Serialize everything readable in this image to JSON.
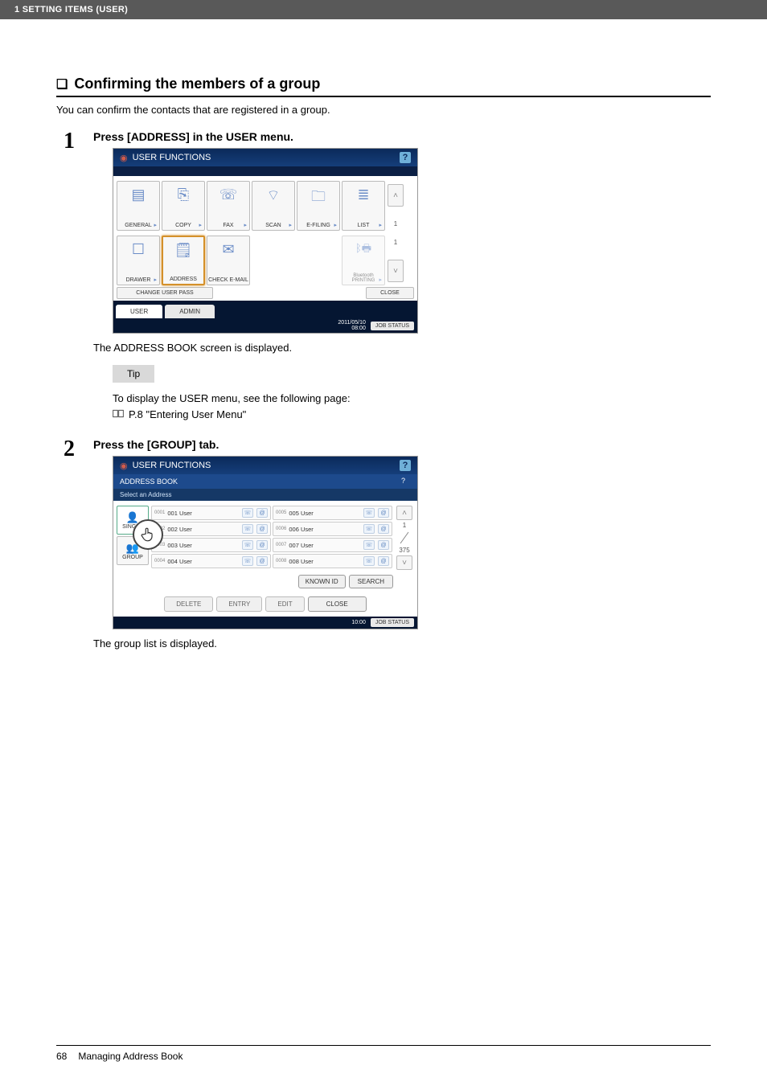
{
  "header": {
    "title": "1 SETTING ITEMS (USER)"
  },
  "section": {
    "bullet": "❏",
    "heading": "Confirming the members of a group",
    "intro": "You can confirm the contacts that are registered in a group."
  },
  "step1": {
    "num": "1",
    "title": "Press [ADDRESS] in the USER menu.",
    "caption": "The ADDRESS BOOK screen is displayed.",
    "panel": {
      "title": "USER FUNCTIONS",
      "help": "?",
      "tiles_row1": [
        {
          "label": "GENERAL"
        },
        {
          "label": "COPY"
        },
        {
          "label": "FAX"
        },
        {
          "label": "SCAN"
        },
        {
          "label": "E-FILING"
        },
        {
          "label": "LIST"
        }
      ],
      "tiles_row2": [
        {
          "label": "DRAWER"
        },
        {
          "label": "ADDRESS",
          "highlighted": true
        },
        {
          "label": "CHECK E-MAIL"
        },
        {
          "label": "Bluetooth PRINTING",
          "disabled": true
        }
      ],
      "pager_top": "1",
      "pager_bot": "1",
      "change_pw": "CHANGE USER PASS",
      "close": "CLOSE",
      "tabs": {
        "user": "USER",
        "admin": "ADMIN"
      },
      "status_date": "2011/05/10\n08:00",
      "status_btn": "JOB STATUS"
    }
  },
  "tip": {
    "label": "Tip",
    "line1": "To display the USER menu, see the following page:",
    "ref": "P.8 \"Entering User Menu\""
  },
  "step2": {
    "num": "2",
    "title": "Press the [GROUP] tab.",
    "caption": "The group list is displayed.",
    "panel": {
      "title": "USER FUNCTIONS",
      "subtitle": "ADDRESS BOOK",
      "help": "?",
      "select": "Select an Address",
      "side_single": "SINGLE",
      "side_group": "GROUP",
      "rows_left": [
        {
          "idx": "0001",
          "name": "001 User"
        },
        {
          "idx": "0002",
          "name": "002 User"
        },
        {
          "idx": "0003",
          "name": "003 User"
        },
        {
          "idx": "0004",
          "name": "004 User"
        }
      ],
      "rows_right": [
        {
          "idx": "0005",
          "name": "005 User"
        },
        {
          "idx": "0006",
          "name": "006 User"
        },
        {
          "idx": "0007",
          "name": "007 User"
        },
        {
          "idx": "0008",
          "name": "008 User"
        }
      ],
      "page_top": "1",
      "page_bot": "375",
      "known_id": "KNOWN ID",
      "search": "SEARCH",
      "buttons": {
        "delete": "DELETE",
        "entry": "ENTRY",
        "edit": "EDIT",
        "close": "CLOSE"
      },
      "status_time": "10:00",
      "status_btn": "JOB STATUS"
    }
  },
  "footer": {
    "page": "68",
    "section": "Managing Address Book"
  }
}
